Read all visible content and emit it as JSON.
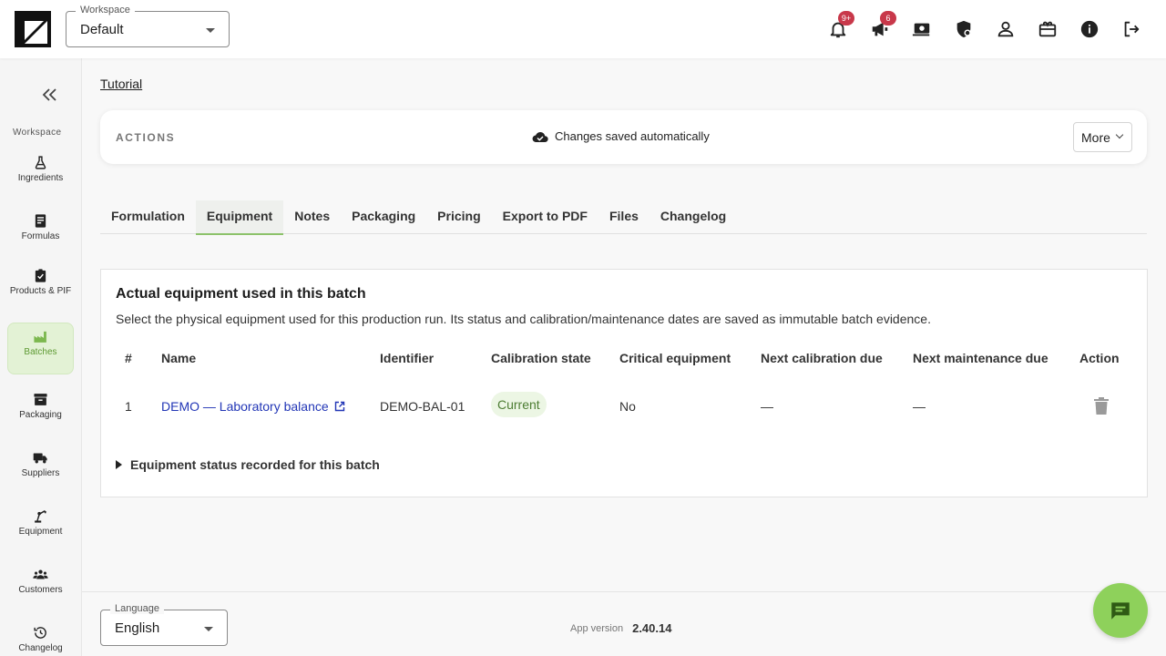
{
  "header": {
    "workspace_legend": "Workspace",
    "workspace_value": "Default",
    "notifications_badge": "9+",
    "announcements_badge": "6"
  },
  "sidebar": {
    "section_label": "Workspace",
    "items": [
      {
        "label": "Ingredients",
        "icon": "flask-icon"
      },
      {
        "label": "Formulas",
        "icon": "document-icon"
      },
      {
        "label": "Products & PIF",
        "icon": "clipboard-check-icon"
      },
      {
        "label": "Batches",
        "icon": "factory-icon",
        "active": true
      },
      {
        "label": "Packaging",
        "icon": "archive-box-icon"
      },
      {
        "label": "Suppliers",
        "icon": "truck-icon"
      },
      {
        "label": "Equipment",
        "icon": "robot-arm-icon"
      },
      {
        "label": "Customers",
        "icon": "people-icon"
      },
      {
        "label": "Changelog",
        "icon": "history-icon"
      }
    ]
  },
  "breadcrumb": "Tutorial",
  "actions": {
    "title": "ACTIONS",
    "saved_text": "Changes saved automatically",
    "more_label": "More"
  },
  "tabs": [
    "Formulation",
    "Equipment",
    "Notes",
    "Packaging",
    "Pricing",
    "Export to PDF",
    "Files",
    "Changelog"
  ],
  "active_tab": "Equipment",
  "equipment": {
    "title": "Actual equipment used in this batch",
    "subtitle": "Select the physical equipment used for this production run. Its status and calibration/maintenance dates are saved as immutable batch evidence.",
    "columns": [
      "#",
      "Name",
      "Identifier",
      "Calibration state",
      "Critical equipment",
      "Next calibration due",
      "Next maintenance due",
      "Action"
    ],
    "rows": [
      {
        "index": "1",
        "name": "DEMO — Laboratory balance",
        "identifier": "DEMO-BAL-01",
        "calibration_state": "Current",
        "critical": "No",
        "next_calibration": "—",
        "next_maintenance": "—"
      }
    ],
    "details_label": "Equipment status recorded for this batch"
  },
  "footer": {
    "language_legend": "Language",
    "language_value": "English",
    "version_label": "App version",
    "version_value": "2.40.14"
  },
  "colors": {
    "accent": "#8ed15b",
    "active_nav_bg": "#e3f2d5",
    "link": "#2236b6",
    "badge": "#c8384a",
    "status_chip_bg": "#ecf6e4"
  }
}
